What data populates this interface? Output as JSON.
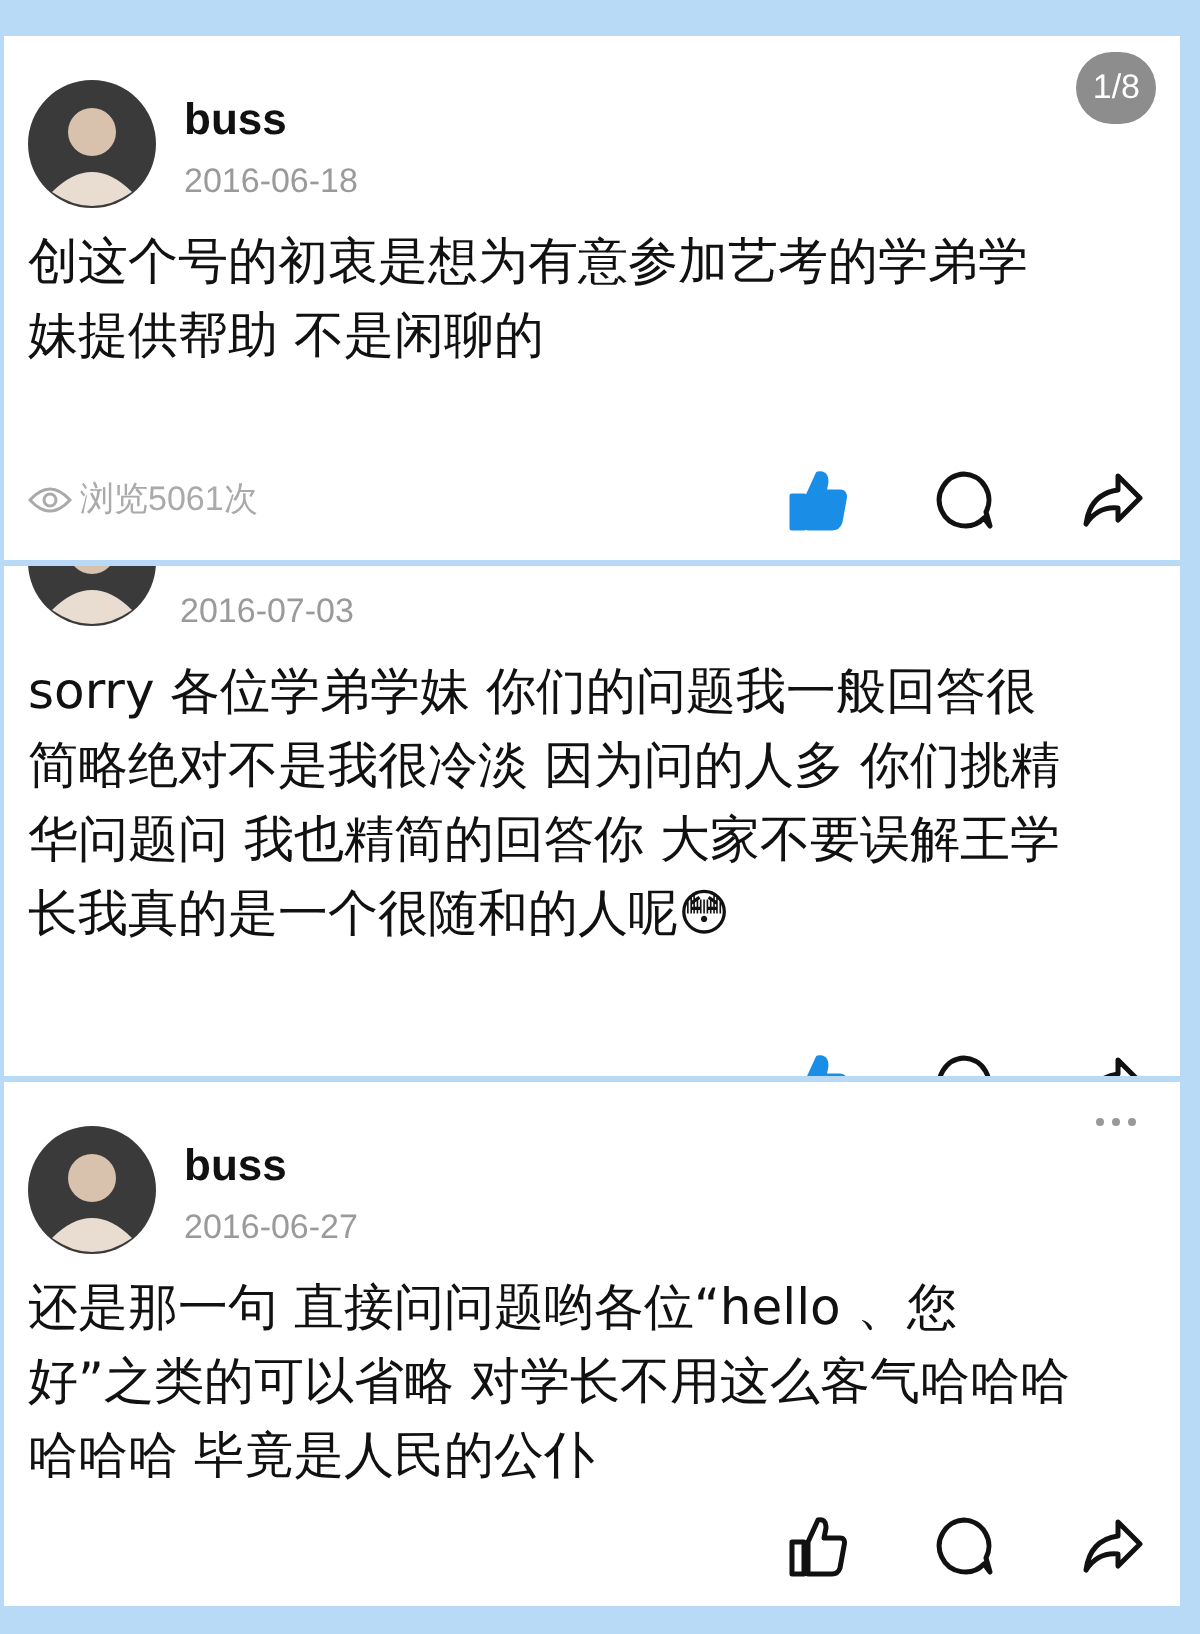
{
  "posts": [
    {
      "kind": "full",
      "author": "buss",
      "date": "2016-06-18",
      "badge": "1/8",
      "text": "创这个号的初衷是想为有意参加艺考的学弟学妹提供帮助 不是闲聊的",
      "views": "浏览5061次",
      "liked": true,
      "more": false
    },
    {
      "kind": "cropped",
      "date": "2016-07-03",
      "text": "sorry 各位学弟学妹 你们的问题我一般回答很简略绝对不是我很冷淡 因为问的人多 你们挑精华问题问 我也精简的回答你 大家不要误解王学长我真的是一个很随和的人呢😳",
      "liked": true,
      "more": false
    },
    {
      "kind": "full",
      "author": "buss",
      "date": "2016-06-27",
      "text": "还是那一句 直接问问题哟各位“hello 、您好”之类的可以省略 对学长不用这么客气哈哈哈哈哈哈 毕竟是人民的公仆",
      "liked": false,
      "more": true
    }
  ]
}
